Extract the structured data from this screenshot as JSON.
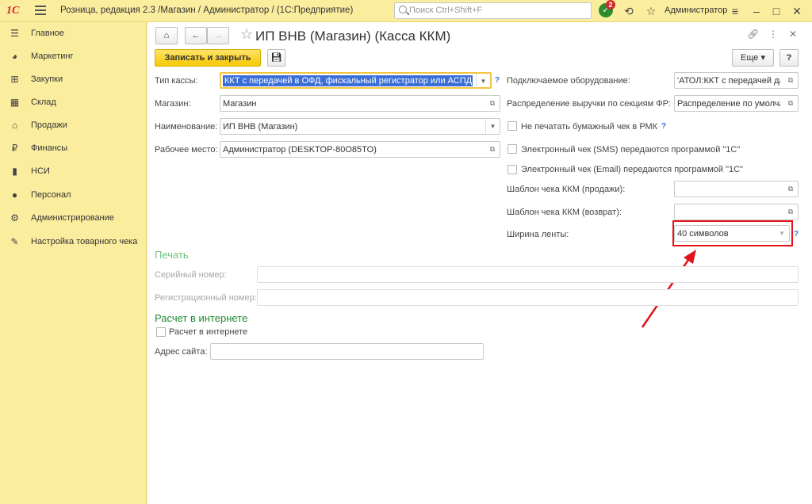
{
  "topbar": {
    "logo": "1С",
    "app_title": "Розница, редакция 2.3 /Магазин / Администратор /  (1С:Предприятие)",
    "search_placeholder": "Поиск Ctrl+Shift+F",
    "notif_count": "2",
    "user": "Администратор"
  },
  "sidebar": {
    "items": [
      {
        "label": "Главное",
        "icon": "menu-icon"
      },
      {
        "label": "Маркетинг",
        "icon": "pie-chart-icon"
      },
      {
        "label": "Закупки",
        "icon": "cart-icon"
      },
      {
        "label": "Склад",
        "icon": "grid-icon"
      },
      {
        "label": "Продажи",
        "icon": "basket-icon"
      },
      {
        "label": "Финансы",
        "icon": "ruble-icon"
      },
      {
        "label": "НСИ",
        "icon": "book-icon"
      },
      {
        "label": "Персонал",
        "icon": "person-icon"
      },
      {
        "label": "Администрирование",
        "icon": "gear-icon"
      },
      {
        "label": "Настройка товарного чека",
        "icon": "wrench-icon"
      }
    ]
  },
  "form": {
    "title": "ИП ВНВ (Магазин) (Касса ККМ)",
    "save_close": "Записать и закрыть",
    "more": "Еще",
    "help": "?",
    "left": {
      "type_label": "Тип кассы:",
      "type_value": "ККТ с передачей в ОФД, фискальный регистратор или АСПД",
      "store_label": "Магазин:",
      "store_value": "Магазин",
      "name_label": "Наименование:",
      "name_value": "ИП ВНВ (Магазин)",
      "workplace_label": "Рабочее место:",
      "workplace_value": "Администратор (DESKTOP-80O85TO)"
    },
    "right": {
      "equipment_label": "Подключаемое оборудование:",
      "equipment_value": "'АТОЛ:ККТ с передачей да",
      "distribution_label": "Распределение выручки по секциям ФР:",
      "distribution_value": "Распределение по умолча",
      "no_print_label": "Не печатать бумажный чек в РМК",
      "sms_label": "Электронный чек (SMS) передаются программой \"1С\"",
      "email_label": "Электронный чек (Email) передаются программой \"1С\"",
      "template_sale_label": "Шаблон чека ККМ (продажи):",
      "template_return_label": "Шаблон чека ККМ (возврат):",
      "tape_label": "Ширина ленты:",
      "tape_value": "40 символов"
    },
    "print": {
      "header": "Печать",
      "serial_label": "Серийный номер:",
      "reg_label": "Регистрационный номер:"
    },
    "internet": {
      "header": "Расчет в интернете",
      "checkbox_label": "Расчет в интернете",
      "site_label": "Адрес сайта:"
    }
  },
  "colors": {
    "section_print": "#6fc27a",
    "section_internet": "#1d8a2f",
    "annotation": "#e3131b"
  }
}
